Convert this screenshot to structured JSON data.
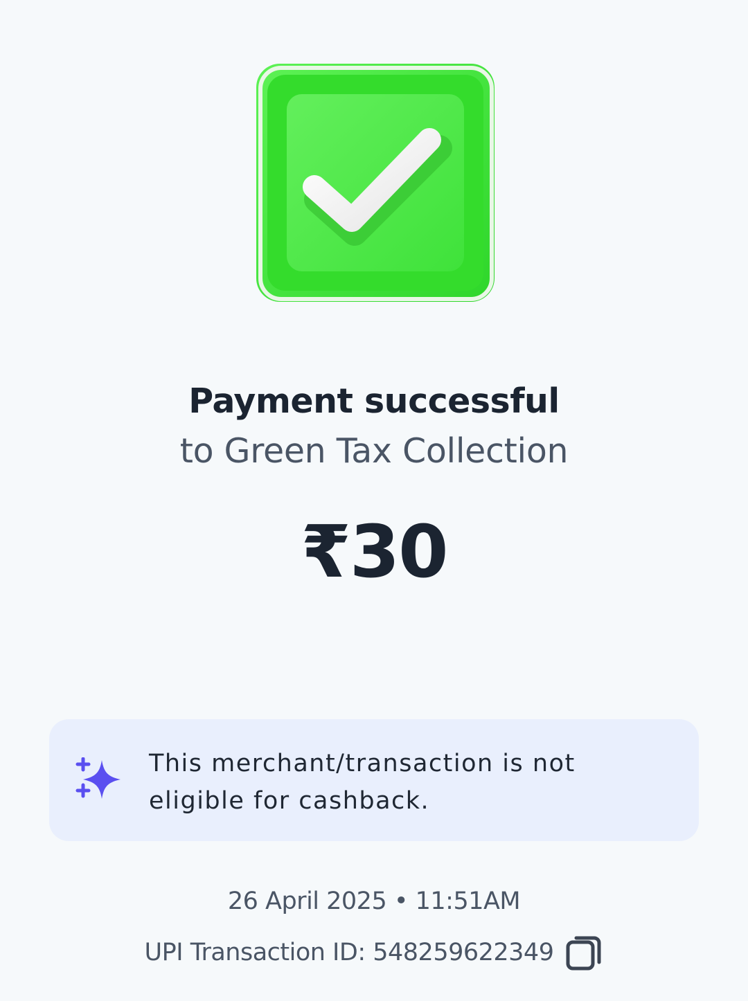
{
  "status": {
    "title": "Payment successful",
    "recipient": "to Green Tax Collection",
    "amount": "₹30"
  },
  "cashback_notice": {
    "icon": "sparkle-icon",
    "line1": "This merchant/transaction is not",
    "line2": "eligible for cashback."
  },
  "transaction": {
    "datetime": "26 April 2025 • 11:51AM",
    "upi_id_text": "UPI Transaction ID: 548259622349",
    "copy_icon": "copy-icon"
  },
  "colors": {
    "success_green": "#3fe33a",
    "accent_purple": "#5a4ff0",
    "card_bg": "#e9effd",
    "page_bg": "#f6f9fb"
  }
}
